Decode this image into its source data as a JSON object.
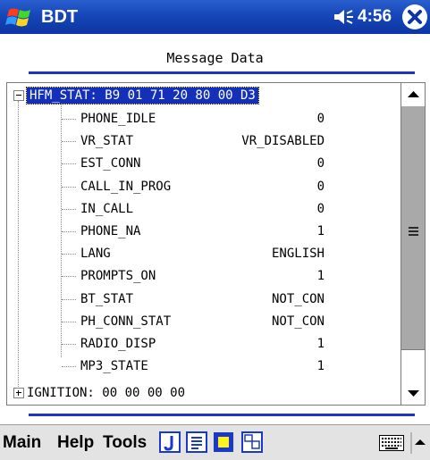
{
  "titlebar": {
    "app_title": "BDT",
    "time": "4:56",
    "icons": {
      "start": "windows-flag-icon",
      "volume": "speaker-icon",
      "close": "close-icon"
    }
  },
  "header": {
    "title": "Message Data"
  },
  "tree": {
    "root": {
      "label": "HFM_STAT: B9 01 71 20 80 00 D3",
      "expanded": true
    },
    "children": [
      {
        "name": "PHONE_IDLE",
        "value": "0"
      },
      {
        "name": "VR_STAT",
        "value": "VR_DISABLED"
      },
      {
        "name": "EST_CONN",
        "value": "0"
      },
      {
        "name": "CALL_IN_PROG",
        "value": "0"
      },
      {
        "name": "IN_CALL",
        "value": "0"
      },
      {
        "name": "PHONE_NA",
        "value": "1"
      },
      {
        "name": "LANG",
        "value": "ENGLISH"
      },
      {
        "name": "PROMPTS_ON",
        "value": "1"
      },
      {
        "name": "BT_STAT",
        "value": "NOT_CON"
      },
      {
        "name": "PH_CONN_STAT",
        "value": "NOT_CON"
      },
      {
        "name": "RADIO_DISP",
        "value": "1"
      },
      {
        "name": "MP3_STATE",
        "value": "1"
      }
    ],
    "second": {
      "label": "IGNITION: 00 00 00 00",
      "expanded": false
    }
  },
  "menubar": {
    "items": [
      "Main",
      "Help",
      "Tools"
    ],
    "tool_icons": [
      "j-icon",
      "document-icon",
      "window-icon",
      "grid-icon"
    ],
    "keyboard": "keyboard-icon",
    "sip": "up-arrow-icon"
  },
  "colors": {
    "titlebar": "#1646b8",
    "accent_rule": "#1e33c4",
    "selection": "#1430b8",
    "scrollbar_track": "#a9a9a9",
    "menubar": "#e3e3e3"
  }
}
